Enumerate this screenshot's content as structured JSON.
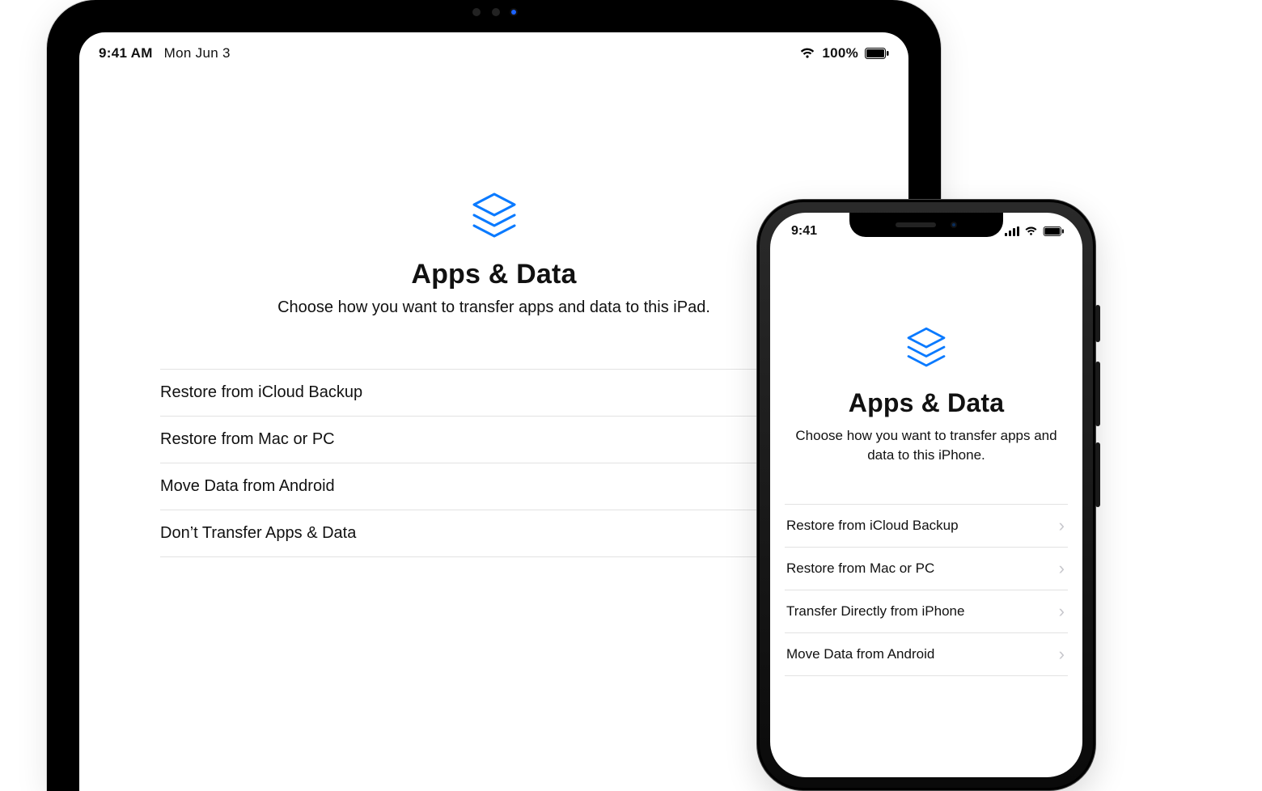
{
  "ipad": {
    "status": {
      "time": "9:41 AM",
      "date": "Mon Jun 3",
      "battery_pct": "100%"
    },
    "title": "Apps & Data",
    "subtitle": "Choose how you want to transfer apps and data to this iPad.",
    "options": [
      {
        "label": "Restore from iCloud Backup"
      },
      {
        "label": "Restore from Mac or PC"
      },
      {
        "label": "Move Data from Android"
      },
      {
        "label": "Don’t Transfer Apps & Data"
      }
    ]
  },
  "iphone": {
    "status": {
      "time": "9:41"
    },
    "title": "Apps & Data",
    "subtitle": "Choose how you want to transfer apps and data to this iPhone.",
    "options": [
      {
        "label": "Restore from iCloud Backup"
      },
      {
        "label": "Restore from Mac or PC"
      },
      {
        "label": "Transfer Directly from iPhone"
      },
      {
        "label": "Move Data from Android"
      }
    ]
  },
  "colors": {
    "accent": "#0a7aff",
    "divider": "#e2e2e2",
    "chevron": "#c7c7cc"
  }
}
